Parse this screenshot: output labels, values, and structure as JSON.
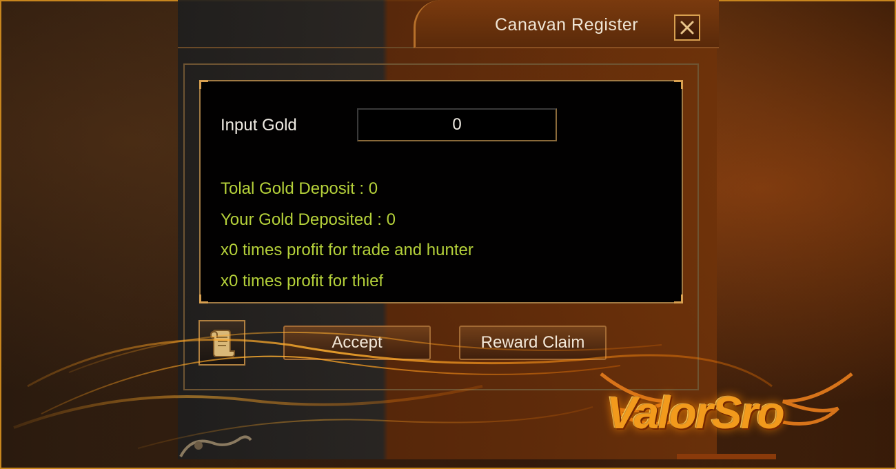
{
  "window": {
    "title": "Canavan Register"
  },
  "form": {
    "input_label": "Input Gold",
    "input_value": "0"
  },
  "info": {
    "total_deposit": "Tolal Gold Deposit : 0",
    "your_deposit": "Your Gold Deposited : 0",
    "trade_hunter_profit": "x0 times profit for trade and hunter",
    "thief_profit": "x0 times profit for thief"
  },
  "buttons": {
    "accept": "Accept",
    "reward_claim": "Reward Claim"
  },
  "logo": {
    "text": "ValorSro"
  },
  "colors": {
    "accent": "#c8861e",
    "info_text": "#b5d13a"
  }
}
